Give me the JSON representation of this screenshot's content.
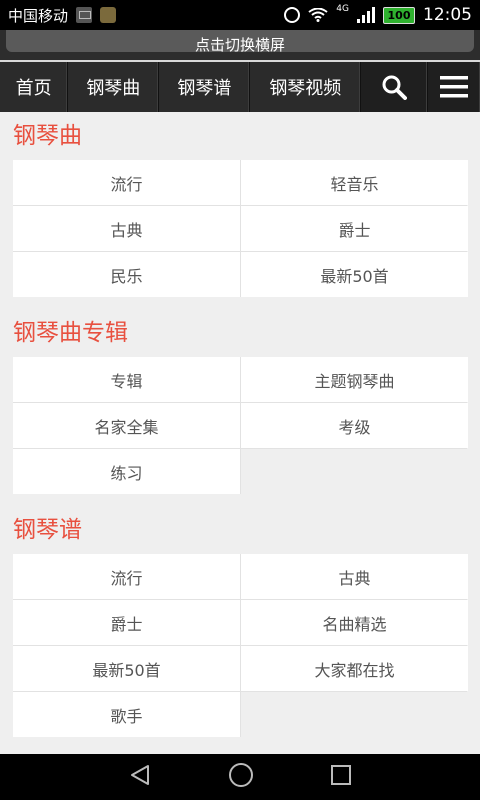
{
  "status_bar": {
    "carrier": "中国移动",
    "network": "4G",
    "battery": "100",
    "time": "12:05"
  },
  "banner": {
    "label": "点击切换横屏"
  },
  "nav": {
    "items": [
      "首页",
      "钢琴曲",
      "钢琴谱",
      "钢琴视频"
    ]
  },
  "sections": [
    {
      "title": "钢琴曲",
      "items": [
        "流行",
        "轻音乐",
        "古典",
        "爵士",
        "民乐",
        "最新50首"
      ]
    },
    {
      "title": "钢琴曲专辑",
      "items": [
        "专辑",
        "主题钢琴曲",
        "名家全集",
        "考级",
        "练习"
      ]
    },
    {
      "title": "钢琴谱",
      "items": [
        "流行",
        "古典",
        "爵士",
        "名曲精选",
        "最新50首",
        "大家都在找",
        "歌手"
      ]
    }
  ],
  "colors": {
    "accent": "#e8503f",
    "nav_bg": "#2b2b2b"
  }
}
